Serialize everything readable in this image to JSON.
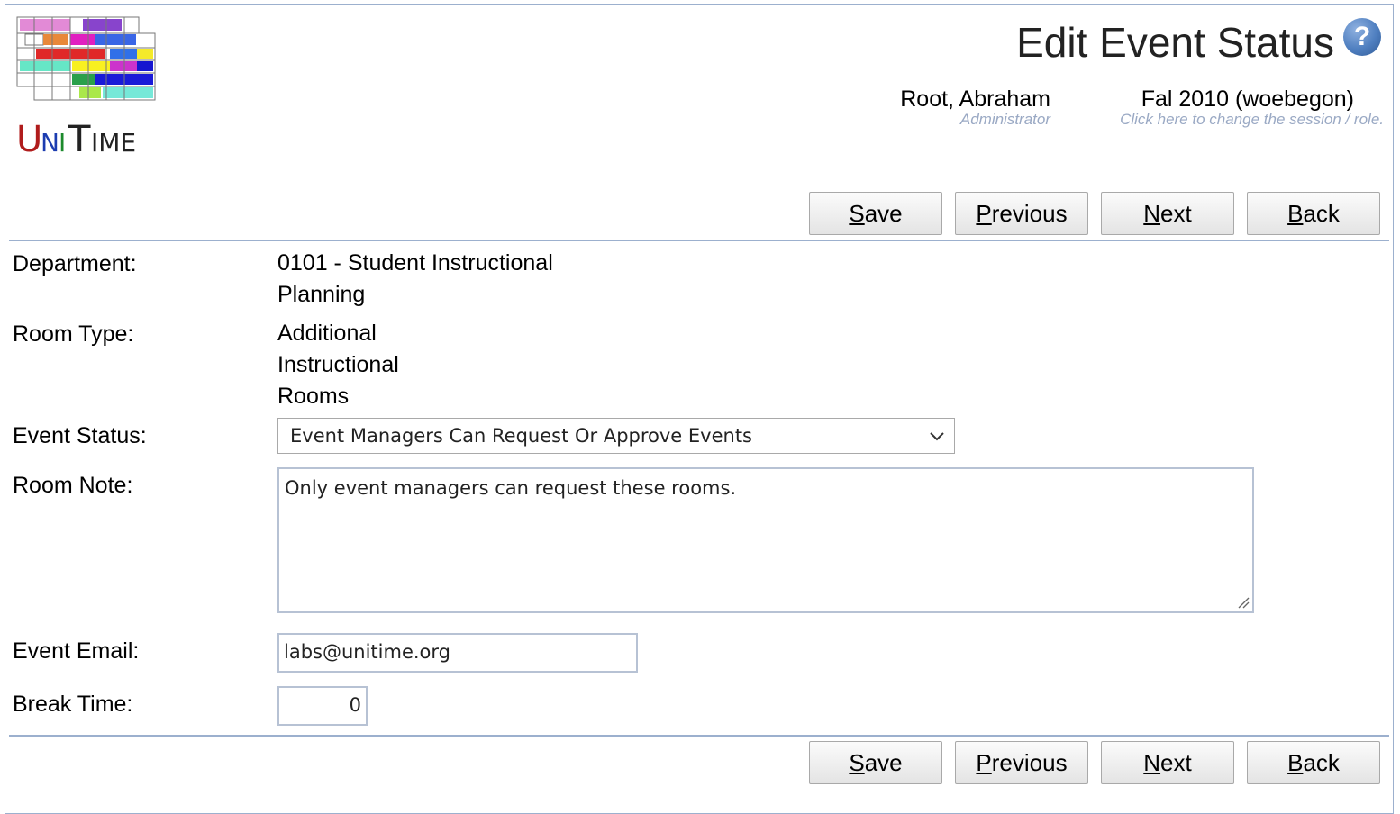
{
  "header": {
    "logo_text": "UniTime",
    "title": "Edit Event Status",
    "help_icon": "help-icon",
    "user": {
      "name": "Root, Abraham",
      "role": "Administrator"
    },
    "session": {
      "name": "Fal 2010 (woebegon)",
      "hint": "Click here to change the session / role."
    }
  },
  "buttons": {
    "save": {
      "first": "S",
      "rest": "ave"
    },
    "previous": {
      "first": "P",
      "rest": "revious"
    },
    "next": {
      "first": "N",
      "rest": "ext"
    },
    "back": {
      "first": "B",
      "rest": "ack"
    }
  },
  "form": {
    "department": {
      "label": "Department:",
      "value_lines": [
        "0101 - Student Instructional",
        "Planning"
      ]
    },
    "room_type": {
      "label": "Room Type:",
      "value_lines": [
        "Additional",
        "Instructional",
        "Rooms"
      ]
    },
    "event_status": {
      "label": "Event Status:",
      "selected": "Event Managers Can Request Or Approve Events"
    },
    "room_note": {
      "label": "Room Note:",
      "value": "Only event managers can request these rooms."
    },
    "event_email": {
      "label": "Event Email:",
      "value": "labs@unitime.org"
    },
    "break_time": {
      "label": "Break Time:",
      "value": "0"
    }
  },
  "colors": {
    "border": "#9cb0ce",
    "hint": "#9aa9c4"
  }
}
